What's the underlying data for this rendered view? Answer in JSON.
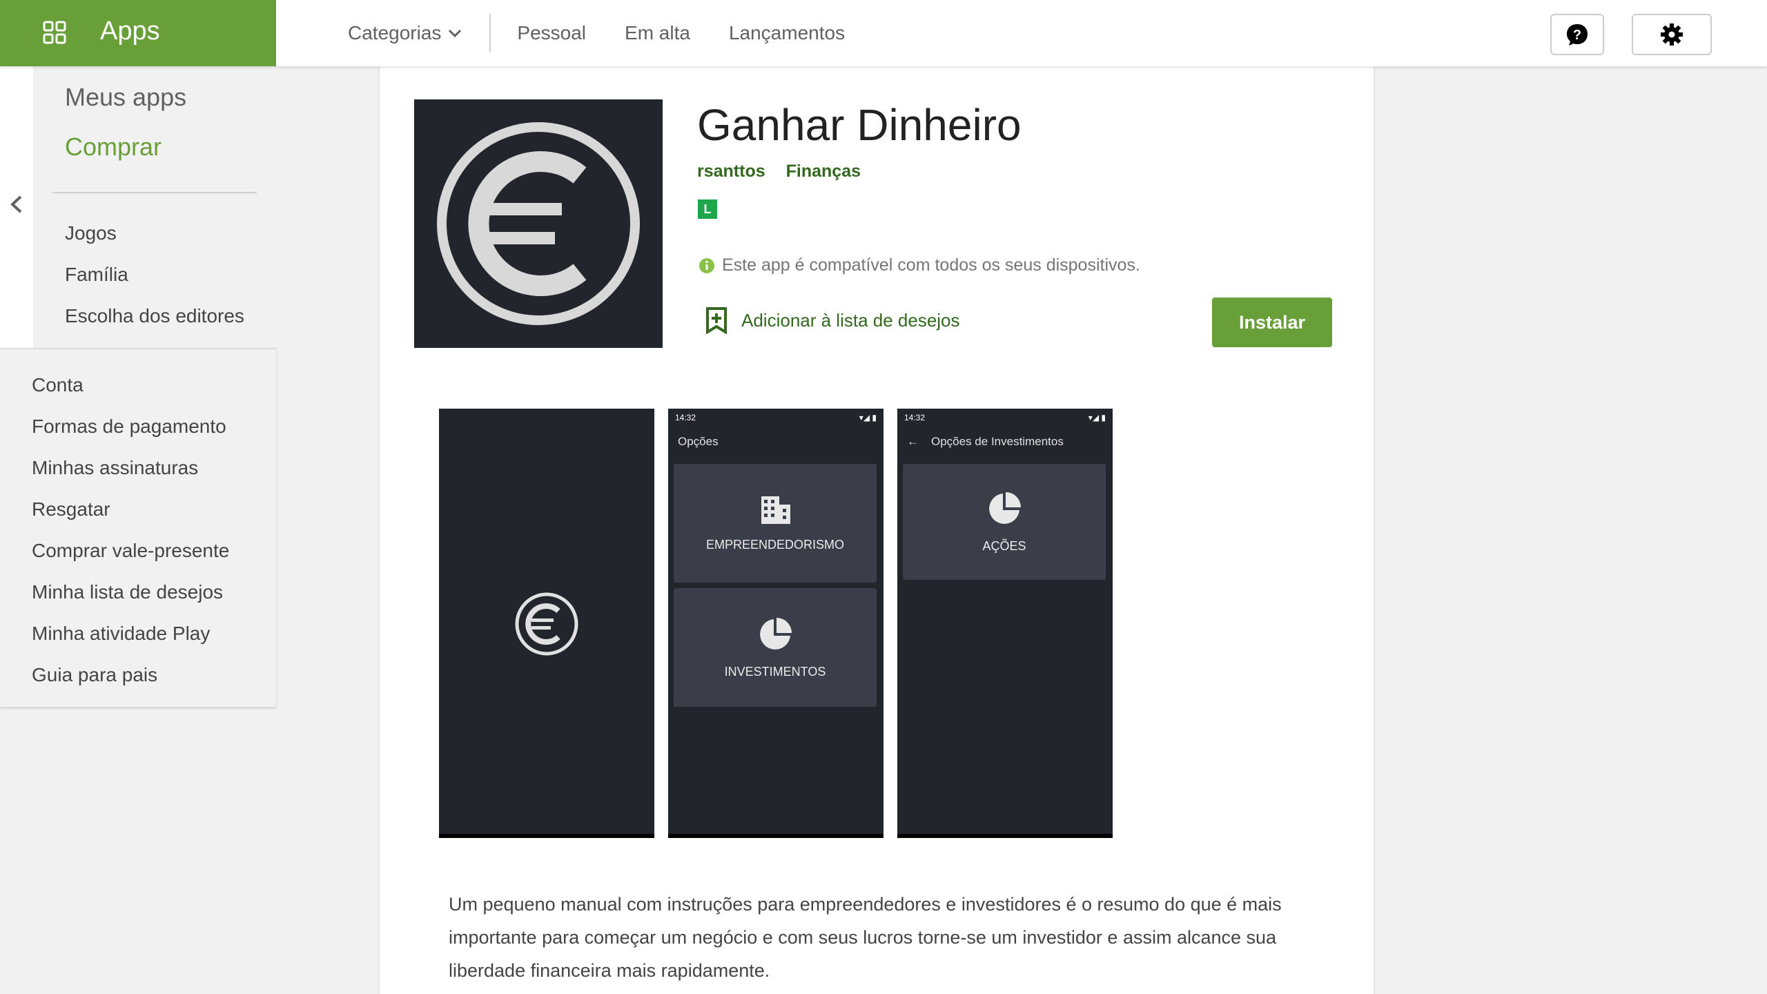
{
  "brand": {
    "title": "Apps",
    "icon": "apps-grid-icon",
    "color": "#689f38"
  },
  "nav": {
    "categories_label": "Categorias",
    "links": [
      "Pessoal",
      "Em alta",
      "Lançamentos"
    ]
  },
  "toolbar": {
    "help_icon": "help-icon",
    "settings_icon": "gear-icon"
  },
  "sidebar": {
    "my_apps": "Meus apps",
    "shop": "Comprar",
    "sections": [
      "Jogos",
      "Família",
      "Escolha dos editores"
    ],
    "account_links": [
      "Conta",
      "Formas de pagamento",
      "Minhas assinaturas",
      "Resgatar",
      "Comprar vale-presente",
      "Minha lista de desejos",
      "Minha atividade Play",
      "Guia para pais"
    ]
  },
  "app": {
    "title": "Ganhar Dinheiro",
    "developer": "rsanttos",
    "category": "Finanças",
    "content_rating": "L",
    "compatibility": "Este app é compatível com todos os seus dispositivos.",
    "wishlist_label": "Adicionar à lista de desejos",
    "install_label": "Instalar",
    "description": "Um pequeno manual com instruções para empreendedores e investidores é o resumo do que é mais importante para começar um negócio e com seus lucros torne-se um investidor e assim alcance sua liberdade financeira mais rapidamente."
  },
  "screenshots": [
    {
      "time": "",
      "header": ""
    },
    {
      "time": "14:32",
      "header": "Opções",
      "tiles": [
        "EMPREENDEDORISMO",
        "INVESTIMENTOS"
      ]
    },
    {
      "time": "14:32",
      "header": "Opções de Investimentos",
      "tiles": [
        "AÇÕES"
      ]
    }
  ]
}
